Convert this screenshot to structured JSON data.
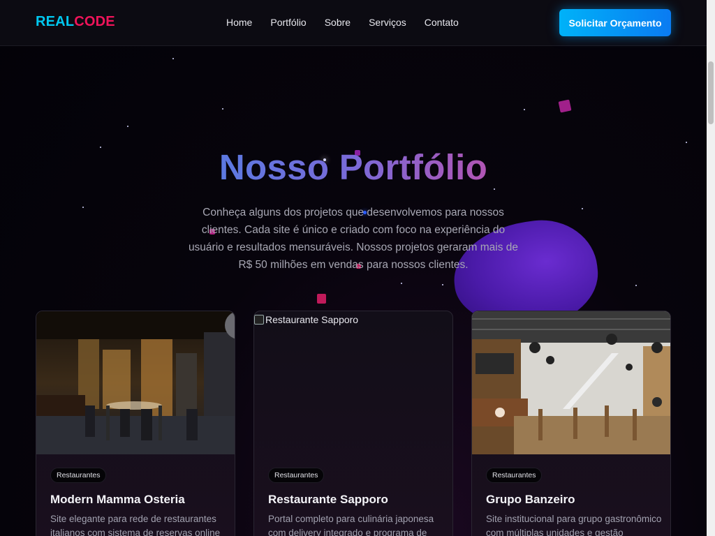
{
  "navbar": {
    "logo_part1": "REAL",
    "logo_part2": "CODE",
    "links": [
      "Home",
      "Portfólio",
      "Sobre",
      "Serviços",
      "Contato"
    ],
    "cta_label": "Solicitar Orçamento"
  },
  "hero": {
    "title": "Nosso Portfólio",
    "description": "Conheça alguns dos projetos que desenvolvemos para nossos clientes. Cada site é único e criado com foco na experiência do usuário e resultados mensuráveis. Nossos projetos geraram mais de R$ 50 milhões em vendas para nossos clientes."
  },
  "cards": [
    {
      "image_icon": "restaurant-interior-photo",
      "badge": "Restaurantes",
      "title": "Modern Mamma Osteria",
      "description": "Site elegante para rede de restaurantes italianos com sistema de reservas online e"
    },
    {
      "image_alt": "Restaurante Sapporo",
      "badge": "Restaurantes",
      "title": "Restaurante Sapporo",
      "description": "Portal completo para culinária japonesa com delivery integrado e programa de"
    },
    {
      "image_icon": "restaurant-interior-photo",
      "badge": "Restaurantes",
      "title": "Grupo Banzeiro",
      "description": "Site institucional para grupo gastronômico com múltiplas unidades e gestão"
    }
  ],
  "colors": {
    "logo_cyan": "#00c8f0",
    "logo_pink": "#f0145a",
    "cta_blue": "#0a9bf5",
    "title_gradient_start": "#4a82e6",
    "title_gradient_end": "#c24ea8"
  }
}
